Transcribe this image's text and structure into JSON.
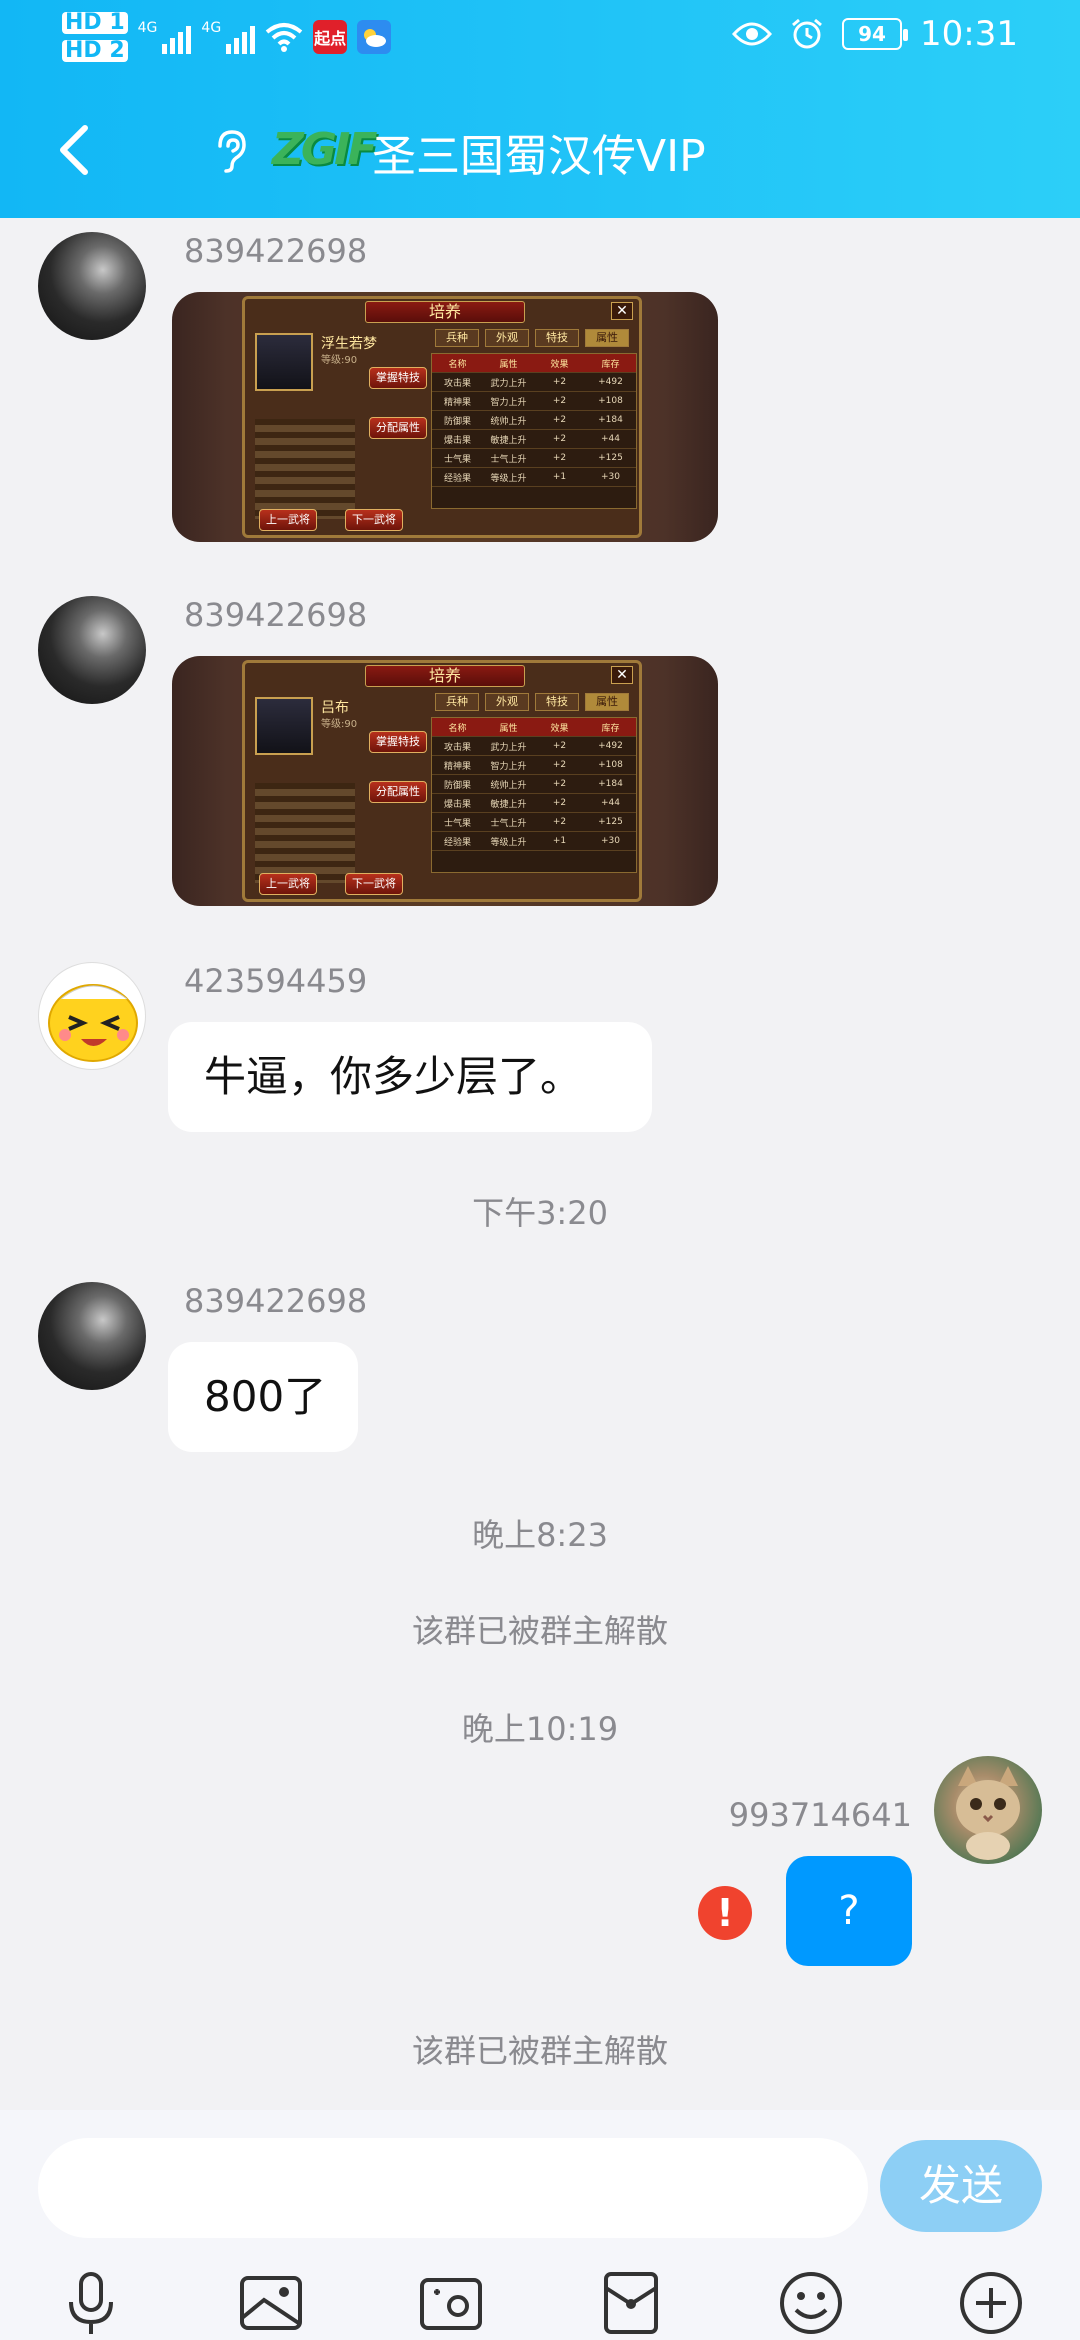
{
  "status_bar": {
    "hd1": "HD 1",
    "hd2": "HD 2",
    "net1": "4G",
    "net2": "4G",
    "app_badge": "起点",
    "battery": "94",
    "time": "10:31"
  },
  "header": {
    "logo": "ZGIF",
    "title": "圣三国蜀汉传VIP",
    "accent": "#12b7f5"
  },
  "messages": {
    "m1": {
      "sender": "839422698",
      "img": {
        "title": "培养",
        "name": "浮生若梦",
        "level": "等级:90",
        "btn_skill": "掌握特技",
        "btn_alloc": "分配属性",
        "btn_prev": "上一武将",
        "btn_next": "下一武将"
      }
    },
    "m2": {
      "sender": "839422698",
      "img": {
        "title": "培养",
        "name": "吕布",
        "level": "等级:90",
        "btn_skill": "掌握特技",
        "btn_alloc": "分配属性",
        "btn_prev": "上一武将",
        "btn_next": "下一武将"
      }
    },
    "m3": {
      "sender": "423594459",
      "text": "牛逼，你多少层了。"
    },
    "t1": "下午3:20",
    "m4": {
      "sender": "839422698",
      "text": "800了"
    },
    "t2": "晚上8:23",
    "sys1": "该群已被群主解散",
    "t3": "晚上10:19",
    "m5": {
      "sender": "993714641",
      "text": "?",
      "fail_mark": "!"
    },
    "sys2": "该群已被群主解散"
  },
  "game_tabs": [
    "兵种",
    "外观",
    "特技",
    "属性"
  ],
  "game_table_head": [
    "名称",
    "属性",
    "效果",
    "库存"
  ],
  "game_table_rows": [
    [
      "攻击果",
      "武力上升",
      "+2",
      "+492"
    ],
    [
      "精神果",
      "智力上升",
      "+2",
      "+108"
    ],
    [
      "防御果",
      "统帅上升",
      "+2",
      "+184"
    ],
    [
      "爆击果",
      "敏捷上升",
      "+2",
      "+44"
    ],
    [
      "士气果",
      "士气上升",
      "+2",
      "+125"
    ],
    [
      "经验果",
      "等级上升",
      "+1",
      "+30"
    ]
  ],
  "input": {
    "placeholder": "",
    "send_label": "发送"
  },
  "toolbar": {
    "icons": [
      "mic-icon",
      "image-icon",
      "camera-icon",
      "red-packet-icon",
      "emoji-icon",
      "plus-icon"
    ]
  }
}
